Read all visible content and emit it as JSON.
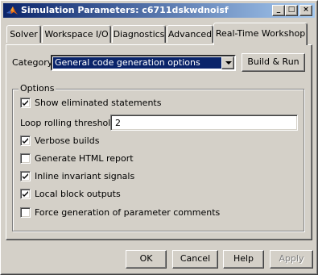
{
  "window": {
    "title": "Simulation Parameters: c6711dskwdnoisf",
    "minimize_glyph": "_",
    "maximize_glyph": "□",
    "close_glyph": "×"
  },
  "tabs": [
    {
      "label": "Solver",
      "active": false
    },
    {
      "label": "Workspace I/O",
      "active": false
    },
    {
      "label": "Diagnostics",
      "active": false
    },
    {
      "label": "Advanced",
      "active": false
    },
    {
      "label": "Real-Time Workshop",
      "active": true
    }
  ],
  "category": {
    "label": "Category:",
    "selected": "General code generation options"
  },
  "build_button": "Build & Run",
  "options": {
    "title": "Options",
    "show_eliminated": {
      "label": "Show eliminated statements",
      "checked": true
    },
    "loop_rolling": {
      "label": "Loop rolling threshold:",
      "value": "2"
    },
    "verbose_builds": {
      "label": "Verbose builds",
      "checked": true
    },
    "html_report": {
      "label": "Generate HTML report",
      "checked": false
    },
    "inline_invariant": {
      "label": "Inline invariant signals",
      "checked": true
    },
    "local_block": {
      "label": "Local block outputs",
      "checked": true
    },
    "force_param_comments": {
      "label": "Force generation of parameter comments",
      "checked": false
    }
  },
  "buttons": {
    "ok": "OK",
    "cancel": "Cancel",
    "help": "Help",
    "apply": "Apply"
  },
  "colors": {
    "titlebar_start": "#0a246a",
    "titlebar_end": "#a6caf0",
    "face": "#d4d0c8",
    "selection": "#0a246a"
  }
}
